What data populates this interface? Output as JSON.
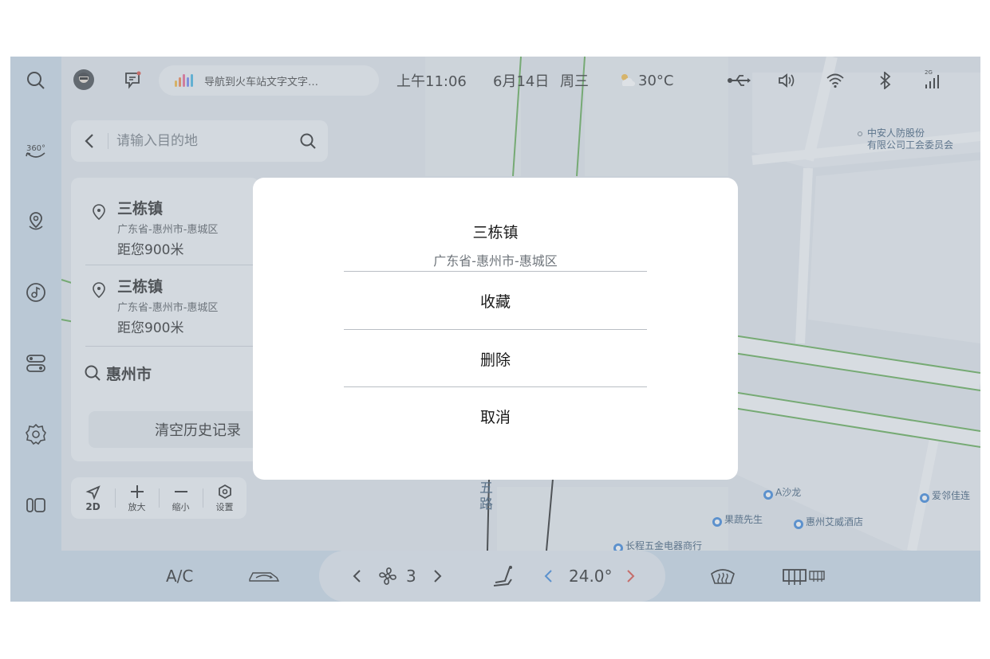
{
  "status_bar": {
    "voice_text": "导航到火车站文字文字…",
    "time": "上午11:06",
    "date": "6月14日",
    "weekday": "周三",
    "temperature": "30°C",
    "signal_label": "2G"
  },
  "search": {
    "placeholder": "请输入目的地"
  },
  "history": {
    "items": [
      {
        "title": "三栋镇",
        "subtitle": "广东省-惠州市-惠城区",
        "distance": "距您900米",
        "icon": "location-pin-icon"
      },
      {
        "title": "三栋镇",
        "subtitle": "广东省-惠州市-惠城区",
        "distance": "距您900米",
        "icon": "location-pin-icon"
      },
      {
        "title": "惠州市",
        "icon": "search-icon"
      }
    ],
    "clear_label": "清空历史记录"
  },
  "map_controls": {
    "mode_label": "2D",
    "zoom_in_label": "放大",
    "zoom_out_label": "缩小",
    "settings_label": "设置"
  },
  "map_labels": {
    "company": "中安人防股份\n有限公司工会委员会",
    "road_five": "五\n路",
    "poi_shalong": "A沙龙",
    "poi_fruit": "果蔬先生",
    "poi_hotel": "惠州艾威酒店",
    "poi_aili": "爱邻佳连",
    "poi_electric": "长程五金电器商行"
  },
  "climate": {
    "ac_label": "A/C",
    "fan_level": "3",
    "temperature": "24.0°"
  },
  "dialog": {
    "title": "三栋镇",
    "subtitle": "广东省-惠州市-惠城区",
    "favorite_label": "收藏",
    "delete_label": "删除",
    "cancel_label": "取消"
  },
  "colors": {
    "accent_blue": "#2f7fd8",
    "accent_red": "#d9463b",
    "voice_bars": [
      "#f2b233",
      "#f07b3f",
      "#e85d8d",
      "#6b7ff2",
      "#3ab0e0"
    ]
  }
}
